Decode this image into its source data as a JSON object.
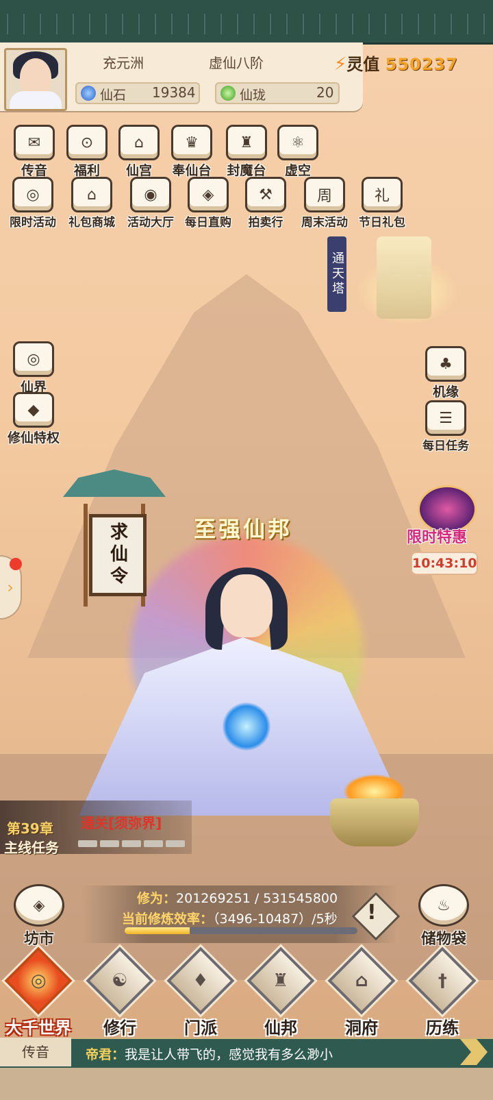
{
  "header": {
    "region": "充元洲",
    "realm": "虚仙八阶",
    "lingzhi_label": "灵值",
    "lingzhi_value": "550237",
    "currencies": [
      {
        "name": "仙石",
        "value": "19384",
        "icon": "blue-gem-icon",
        "color": "#3b6fd8"
      },
      {
        "name": "仙珑",
        "value": "20",
        "icon": "green-jade-icon",
        "color": "#5cbf3b"
      }
    ]
  },
  "top_icons_row1": [
    {
      "label": "传音",
      "icon": "envelope-icon",
      "glyph": "✉"
    },
    {
      "label": "福利",
      "icon": "gift-box-icon",
      "glyph": "⊙"
    },
    {
      "label": "仙宫",
      "icon": "palace-icon",
      "glyph": "⌂"
    },
    {
      "label": "奉仙台",
      "icon": "altar-icon",
      "glyph": "♛"
    },
    {
      "label": "封魔台",
      "icon": "seal-icon",
      "glyph": "♜"
    },
    {
      "label": "虚空",
      "icon": "atom-icon",
      "glyph": "⚛"
    }
  ],
  "top_icons_row2": [
    {
      "label": "限时活动",
      "icon": "timed-event-icon",
      "glyph": "◎"
    },
    {
      "label": "礼包商城",
      "icon": "gift-shop-icon",
      "glyph": "⌂"
    },
    {
      "label": "活动大厅",
      "icon": "event-hall-icon",
      "glyph": "◉"
    },
    {
      "label": "每日直购",
      "icon": "coin-icon",
      "glyph": "◈"
    },
    {
      "label": "拍卖行",
      "icon": "auction-hammer-icon",
      "glyph": "⚒"
    },
    {
      "label": "周末活动",
      "icon": "weekend-calendar-icon",
      "glyph": "周"
    },
    {
      "label": "节日礼包",
      "icon": "festival-bag-icon",
      "glyph": "礼"
    }
  ],
  "tower_banner": "通天塔",
  "left_side": [
    {
      "label": "仙界",
      "icon": "immortal-realm-icon",
      "glyph": "◎"
    },
    {
      "label": "修仙特权",
      "icon": "turtle-icon",
      "glyph": "◆"
    }
  ],
  "right_side": [
    {
      "label": "机缘",
      "icon": "fortune-gourd-icon",
      "glyph": "♣"
    },
    {
      "label": "每日任务",
      "icon": "scroll-icon",
      "glyph": "☰"
    }
  ],
  "gate_board": "求仙令",
  "sect_title": "至强仙邦",
  "limited_offer": {
    "label": "限时特惠",
    "timer": "10:43:10"
  },
  "quest": {
    "chapter": "第39章",
    "type": "主线任务",
    "name": "通关[须弥界]",
    "segments": 5
  },
  "cultivation": {
    "label1": "修为：",
    "value1": "201269251 / 531545800",
    "progress": 0.28,
    "label2": "当前修炼效率：",
    "value2": "（3496-10487）/5秒",
    "warn": "!"
  },
  "market": {
    "label": "坊市",
    "icon": "market-icon",
    "glyph": "◈"
  },
  "storage": {
    "label": "储物袋",
    "icon": "storage-bag-icon",
    "glyph": "♨"
  },
  "bottom_nav": [
    {
      "label": "大千世界",
      "icon": "world-vortex-icon",
      "glyph": "◎",
      "active": true
    },
    {
      "label": "修行",
      "icon": "yin-yang-icon",
      "glyph": "☯",
      "active": false
    },
    {
      "label": "门派",
      "icon": "sect-shield-icon",
      "glyph": "♦",
      "active": false
    },
    {
      "label": "仙邦",
      "icon": "alliance-banner-icon",
      "glyph": "♜",
      "active": false
    },
    {
      "label": "洞府",
      "icon": "cave-mansion-icon",
      "glyph": "⌂",
      "active": false
    },
    {
      "label": "历练",
      "icon": "sword-icon",
      "glyph": "†",
      "active": false
    }
  ],
  "chat": {
    "channel": "传音",
    "sender": "帝君：",
    "message": "我是让人带飞的，感觉我有多么渺小"
  }
}
